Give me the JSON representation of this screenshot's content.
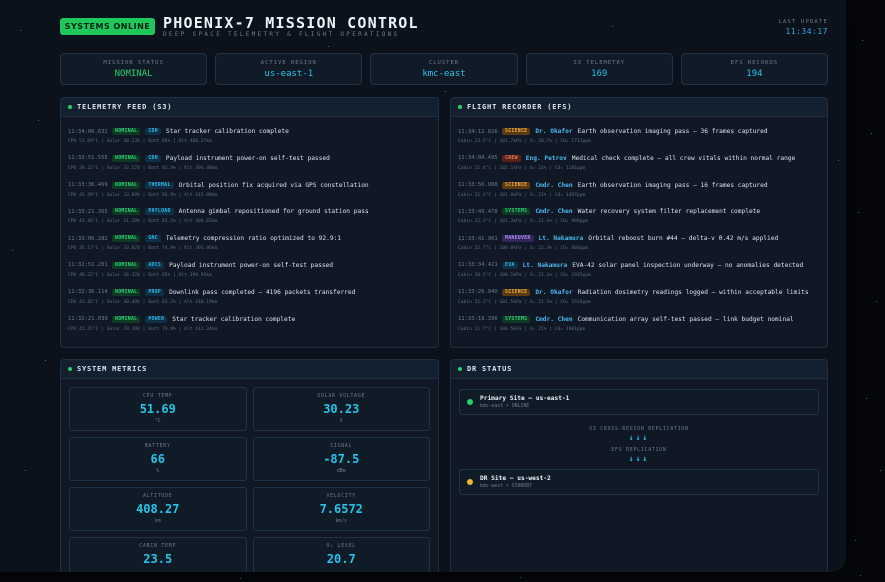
{
  "header": {
    "status_badge": "SYSTEMS ONLINE",
    "title": "PHOENIX-7 MISSION CONTROL",
    "subtitle": "DEEP SPACE TELEMETRY & FLIGHT OPERATIONS",
    "last_update_label": "LAST UPDATE",
    "last_update_time": "11:34:17"
  },
  "stats": [
    {
      "label": "MISSION STATUS",
      "value": "NOMINAL",
      "color": "#27d06a"
    },
    {
      "label": "ACTIVE REGION",
      "value": "us-east-1",
      "color": "#27c4e8"
    },
    {
      "label": "CLUSTER",
      "value": "kmc-east",
      "color": "#27c4e8"
    },
    {
      "label": "S3 TELEMETRY",
      "value": "169",
      "color": "#27c4e8"
    },
    {
      "label": "EFS RECORDS",
      "value": "194",
      "color": "#27c4e8"
    }
  ],
  "telemetry": {
    "title": "TELEMETRY FEED (S3)",
    "entries": [
      {
        "time": "11:34:06.632",
        "status": "NOMINAL",
        "sub": "CDH",
        "msg": "Star tracker calibration complete",
        "detail": "CPU 51.69°C | Solar 30.23V | Batt 66% | Alt 408.27km"
      },
      {
        "time": "11:33:51.555",
        "status": "NOMINAL",
        "sub": "CDH",
        "msg": "Payload instrument power-on self-test passed",
        "detail": "CPU 39.22°C | Solar 33.52V | Batt 92.4% | Alt 394.48km"
      },
      {
        "time": "11:33:36.469",
        "status": "NOMINAL",
        "sub": "THERMAL",
        "msg": "Orbital position fix acquired via GPS constellation",
        "detail": "CPU 45.59°C | Solar 33.89V | Batt 93.9% | Alt 415.89km"
      },
      {
        "time": "11:33:21.365",
        "status": "NOMINAL",
        "sub": "PAYLOAD",
        "msg": "Antenna gimbal repositioned for ground station pass",
        "detail": "CPU 41.46°C | Solar 31.19V | Batt 83.2% | Alt 404.65km"
      },
      {
        "time": "11:33:06.282",
        "status": "NOMINAL",
        "sub": "GNC",
        "msg": "Telemetry compression ratio optimized to 92.9:1",
        "detail": "CPU 35.17°C | Solar 33.82V | Batt 74.9% | Alt 393.96km"
      },
      {
        "time": "11:32:51.201",
        "status": "NOMINAL",
        "sub": "ADCS",
        "msg": "Payload instrument power-on self-test passed",
        "detail": "CPU 48.22°C | Solar 34.32V | Batt 65% | Alt 399.95km"
      },
      {
        "time": "11:32:36.114",
        "status": "NOMINAL",
        "sub": "PROP",
        "msg": "Downlink pass completed — 4196 packets transferred",
        "detail": "CPU 43.85°C | Solar 30.49V | Batt 63.2% | Alt 410.19km"
      },
      {
        "time": "11:32:21.039",
        "status": "NOMINAL",
        "sub": "POWER",
        "msg": "Star tracker calibration complete",
        "detail": "CPU 41.35°C | Solar 29.39V | Batt 79.8% | Alt 412.34km"
      }
    ]
  },
  "recorder": {
    "title": "FLIGHT RECORDER (EFS)",
    "entries": [
      {
        "time": "11:34:12.816",
        "cat": "SCIENCE",
        "who": "Dr. Okafor",
        "msg": "Earth observation imaging pass — 36 frames captured",
        "detail": "Cabin 23.5°C | 101.7kPa | O₂ 20.7% | CO₂ 1731ppm"
      },
      {
        "time": "11:34:04.495",
        "cat": "CREW",
        "who": "Eng. Petrov",
        "msg": "Medical check complete — all crew vitals within normal range",
        "detail": "Cabin 21.4°C | 102.1kPa | O₂ 21% | CO₂ 1181ppm"
      },
      {
        "time": "11:33:56.988",
        "cat": "SCIENCE",
        "who": "Cmdr. Chen",
        "msg": "Earth observation imaging pass — 16 frames captured",
        "detail": "Cabin 21.1°C | 101.8kPa | O₂ 21% | CO₂ 1497ppm"
      },
      {
        "time": "11:33:49.478",
        "cat": "SYSTEMS",
        "who": "Cmdr. Chen",
        "msg": "Water recovery system filter replacement complete",
        "detail": "Cabin 22.3°C | 101.3kPa | O₂ 21.4% | CO₂ 989ppm"
      },
      {
        "time": "11:33:41.961",
        "cat": "MANEUVER",
        "who": "Lt. Nakamura",
        "msg": "Orbital reboost burn #44 — delta-v 0.42 m/s applied",
        "detail": "Cabin 22.7°C | 100.8kPa | O₂ 21.3% | CO₂ 884ppm"
      },
      {
        "time": "11:33:34.421",
        "cat": "EVA",
        "who": "Lt. Nakamura",
        "msg": "EVA-42 solar panel inspection underway — no anomalies detected",
        "detail": "Cabin 20.5°C | 100.5kPa | O₂ 21.1% | CO₂ 1935ppm"
      },
      {
        "time": "11:33:26.940",
        "cat": "SCIENCE",
        "who": "Dr. Okafor",
        "msg": "Radiation dosimetry readings logged — within acceptable limits",
        "detail": "Cabin 21.3°C | 101.5kPa | O₂ 21.1% | CO₂ 1916ppm"
      },
      {
        "time": "11:33:19.396",
        "cat": "SYSTEMS",
        "who": "Cmdr. Chen",
        "msg": "Communication array self-test passed — link budget nominal",
        "detail": "Cabin 21.7°C | 100.5kPa | O₂ 21% | CO₂ 1901ppm"
      }
    ]
  },
  "metrics": {
    "title": "SYSTEM METRICS",
    "items": [
      {
        "label": "CPU TEMP",
        "value": "51.69",
        "unit": "°C"
      },
      {
        "label": "SOLAR VOLTAGE",
        "value": "30.23",
        "unit": "V"
      },
      {
        "label": "BATTERY",
        "value": "66",
        "unit": "%"
      },
      {
        "label": "SIGNAL",
        "value": "-87.5",
        "unit": "dBm"
      },
      {
        "label": "ALTITUDE",
        "value": "408.27",
        "unit": "km"
      },
      {
        "label": "VELOCITY",
        "value": "7.6572",
        "unit": "km/s"
      },
      {
        "label": "CABIN TEMP",
        "value": "23.5",
        "unit": ""
      },
      {
        "label": "O₂ LEVEL",
        "value": "20.7",
        "unit": ""
      }
    ]
  },
  "dr": {
    "title": "DR STATUS",
    "primary": {
      "name": "Primary Site — us-east-1",
      "sub": "kmc-east • ONLINE",
      "color": "#27d06a"
    },
    "s3_label": "S3 CROSS-REGION REPLICATION",
    "efs_label": "EFS REPLICATION",
    "arrows": "↓↓↓",
    "secondary": {
      "name": "DR Site — us-west-2",
      "sub": "kmc-west • STANDBY",
      "color": "#f2b62e"
    }
  }
}
